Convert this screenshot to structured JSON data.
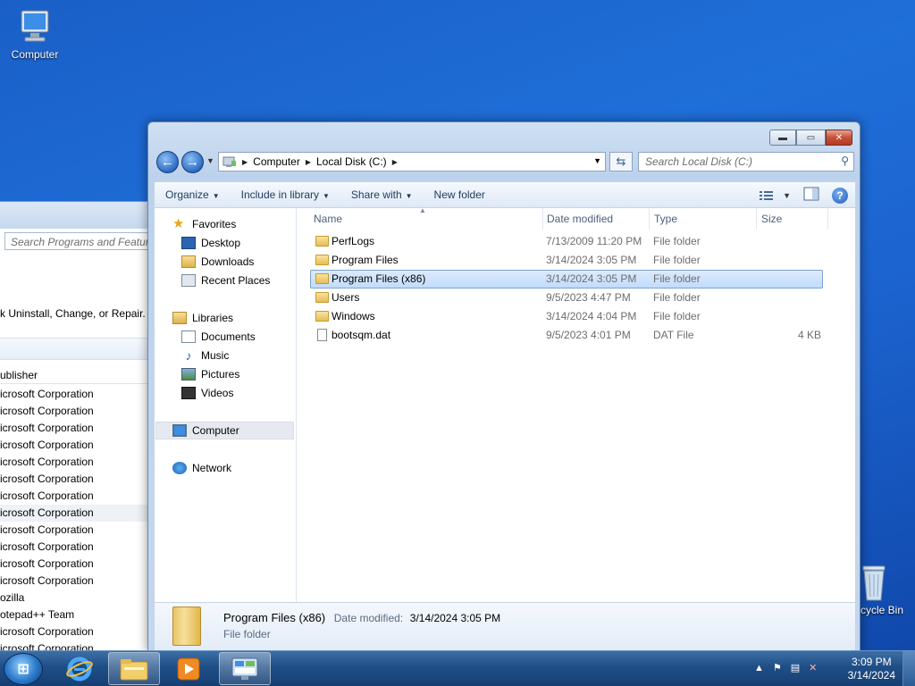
{
  "desktop": {
    "computer_label": "Computer",
    "recycle_label": "cycle Bin"
  },
  "bg_window": {
    "search_placeholder": "Search Programs and Features",
    "hint": "k Uninstall, Change, or Repair.",
    "column_publisher": "ublisher",
    "rows": [
      "icrosoft Corporation",
      "icrosoft Corporation",
      "icrosoft Corporation",
      "icrosoft Corporation",
      "icrosoft Corporation",
      "icrosoft Corporation",
      "icrosoft Corporation",
      "icrosoft Corporation",
      "icrosoft Corporation",
      "icrosoft Corporation",
      "icrosoft Corporation",
      "icrosoft Corporation",
      "ozilla",
      "otepad++ Team",
      "icrosoft Corporation",
      "icrosoft Corporation"
    ]
  },
  "explorer": {
    "caption": {
      "min": "▬",
      "max": "▭",
      "close": "✕"
    },
    "nav": {
      "back": "←",
      "forward": "→"
    },
    "breadcrumb": [
      "Computer",
      "Local Disk (C:)"
    ],
    "search_placeholder": "Search Local Disk (C:)",
    "commands": {
      "organize": "Organize",
      "include": "Include in library",
      "share": "Share with",
      "new_folder": "New folder"
    },
    "sidebar": {
      "favorites": "Favorites",
      "desktop": "Desktop",
      "downloads": "Downloads",
      "recent": "Recent Places",
      "libraries": "Libraries",
      "documents": "Documents",
      "music": "Music",
      "pictures": "Pictures",
      "videos": "Videos",
      "computer": "Computer",
      "network": "Network"
    },
    "columns": {
      "name": "Name",
      "date": "Date modified",
      "type": "Type",
      "size": "Size"
    },
    "files": [
      {
        "name": "PerfLogs",
        "date": "7/13/2009 11:20 PM",
        "type": "File folder",
        "size": "",
        "kind": "folder"
      },
      {
        "name": "Program Files",
        "date": "3/14/2024 3:05 PM",
        "type": "File folder",
        "size": "",
        "kind": "folder"
      },
      {
        "name": "Program Files (x86)",
        "date": "3/14/2024 3:05 PM",
        "type": "File folder",
        "size": "",
        "kind": "folder",
        "selected": true
      },
      {
        "name": "Users",
        "date": "9/5/2023 4:47 PM",
        "type": "File folder",
        "size": "",
        "kind": "folder"
      },
      {
        "name": "Windows",
        "date": "3/14/2024 4:04 PM",
        "type": "File folder",
        "size": "",
        "kind": "folder"
      },
      {
        "name": "bootsqm.dat",
        "date": "9/5/2023 4:01 PM",
        "type": "DAT File",
        "size": "4 KB",
        "kind": "file"
      }
    ],
    "details": {
      "name": "Program Files (x86)",
      "date_label": "Date modified:",
      "date_value": "3/14/2024 3:05 PM",
      "type": "File folder"
    }
  },
  "taskbar": {
    "time": "3:09 PM",
    "date": "3/14/2024"
  },
  "colors": {
    "desktop": "#1f6fd8",
    "selection": "#c1dcfc",
    "taskbar": "#1f4e86"
  }
}
